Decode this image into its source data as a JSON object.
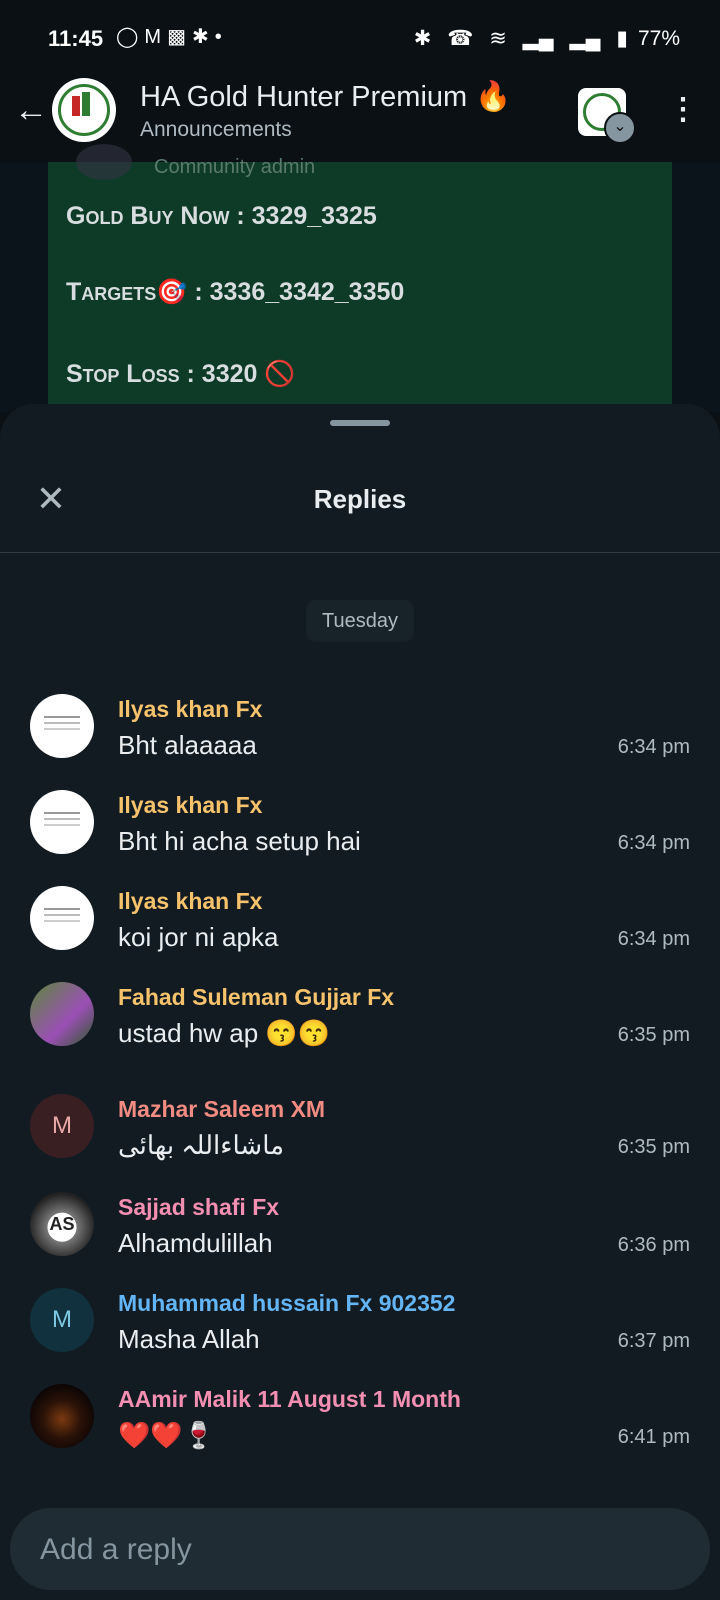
{
  "status_bar": {
    "time": "11:45",
    "left_icons": [
      "snapchat-icon",
      "gmail-icon",
      "sim-icon",
      "app-icon",
      "dot-icon"
    ],
    "battery": "77%"
  },
  "header": {
    "title": "HA Gold Hunter Premium 🔥",
    "subtitle": "Announcements"
  },
  "message": {
    "author_role": "Community admin",
    "lines": [
      {
        "label": "Gold Buy Now",
        "value": " : 3329_3325"
      },
      {
        "label": "Targets",
        "value": "🎯 : 3336_3342_3350"
      },
      {
        "label": "Stop Loss",
        "value": " : 3320 🚫"
      }
    ]
  },
  "sheet": {
    "title": "Replies",
    "date": "Tuesday",
    "input_placeholder": "Add a reply"
  },
  "replies": [
    {
      "name": "Ilyas khan Fx",
      "text": "Bht alaaaaa",
      "time": "6:34 pm",
      "color": "#f6c26b",
      "avatar": "",
      "avatar_class": "av-white"
    },
    {
      "name": "Ilyas khan Fx",
      "text": "Bht hi acha setup hai",
      "time": "6:34 pm",
      "color": "#f6c26b",
      "avatar": "",
      "avatar_class": "av-white"
    },
    {
      "name": "Ilyas khan Fx",
      "text": "koi jor ni apka",
      "time": "6:34 pm",
      "color": "#f6c26b",
      "avatar": "",
      "avatar_class": "av-white"
    },
    {
      "name": "Fahad Suleman Gujjar Fx",
      "text": "ustad hw ap 😙😙",
      "time": "6:35 pm",
      "color": "#f6c26b",
      "avatar": "",
      "avatar_class": "av-photo1"
    },
    {
      "name": "Mazhar Saleem XM",
      "text": "ماشاءاللہ بھائی",
      "time": "6:35 pm",
      "color": "#f28b82",
      "avatar": "M",
      "avatar_class": "av-mletter"
    },
    {
      "name": "Sajjad shafi Fx",
      "text": "Alhamdulillah",
      "time": "6:36 pm",
      "color": "#f48fb1",
      "avatar": "AS",
      "avatar_class": "av-sajjad"
    },
    {
      "name": "Muhammad hussain Fx 902352",
      "text": "Masha Allah",
      "time": "6:37 pm",
      "color": "#64b5f6",
      "avatar": "M",
      "avatar_class": "av-mletter2"
    },
    {
      "name": "AAmir Malik 11 August 1 Month",
      "text": "❤️❤️🍷",
      "time": "6:41 pm",
      "color": "#f48fb1",
      "avatar": "",
      "avatar_class": "av-dark"
    }
  ]
}
